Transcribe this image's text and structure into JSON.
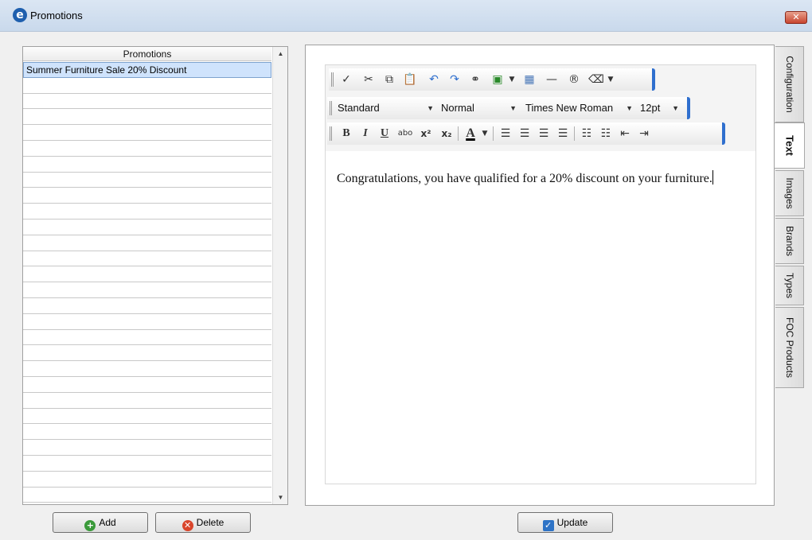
{
  "window": {
    "title": "Promotions",
    "app_icon_glyph": "e",
    "close_glyph": "✕"
  },
  "list": {
    "header": "Promotions",
    "items": [
      "Summer Furniture Sale 20% Discount"
    ],
    "selected_index": 0
  },
  "buttons": {
    "add": "Add",
    "delete": "Delete",
    "update": "Update"
  },
  "toolbar": {
    "style_value": "Standard",
    "format_value": "Normal",
    "font_value": "Times New Roman",
    "size_value": "12pt",
    "bold_label": "B",
    "italic_label": "I",
    "underline_label": "U",
    "strike_label": "abo",
    "superscript_label": "x²",
    "subscript_label": "x₂",
    "font_color_label": "A"
  },
  "editor": {
    "content": "Congratulations, you have qualified for a 20% discount on your furniture."
  },
  "tabs": [
    {
      "label": "Configuration",
      "active": false
    },
    {
      "label": "Text",
      "active": true
    },
    {
      "label": "Images",
      "active": false
    },
    {
      "label": "Brands",
      "active": false
    },
    {
      "label": "Types",
      "active": false
    },
    {
      "label": "FOC Products",
      "active": false
    }
  ],
  "colors": {
    "titlebar": "#c9d9ec",
    "selection": "#cfe3fc",
    "toolbar_accent": "#2f6fce"
  }
}
